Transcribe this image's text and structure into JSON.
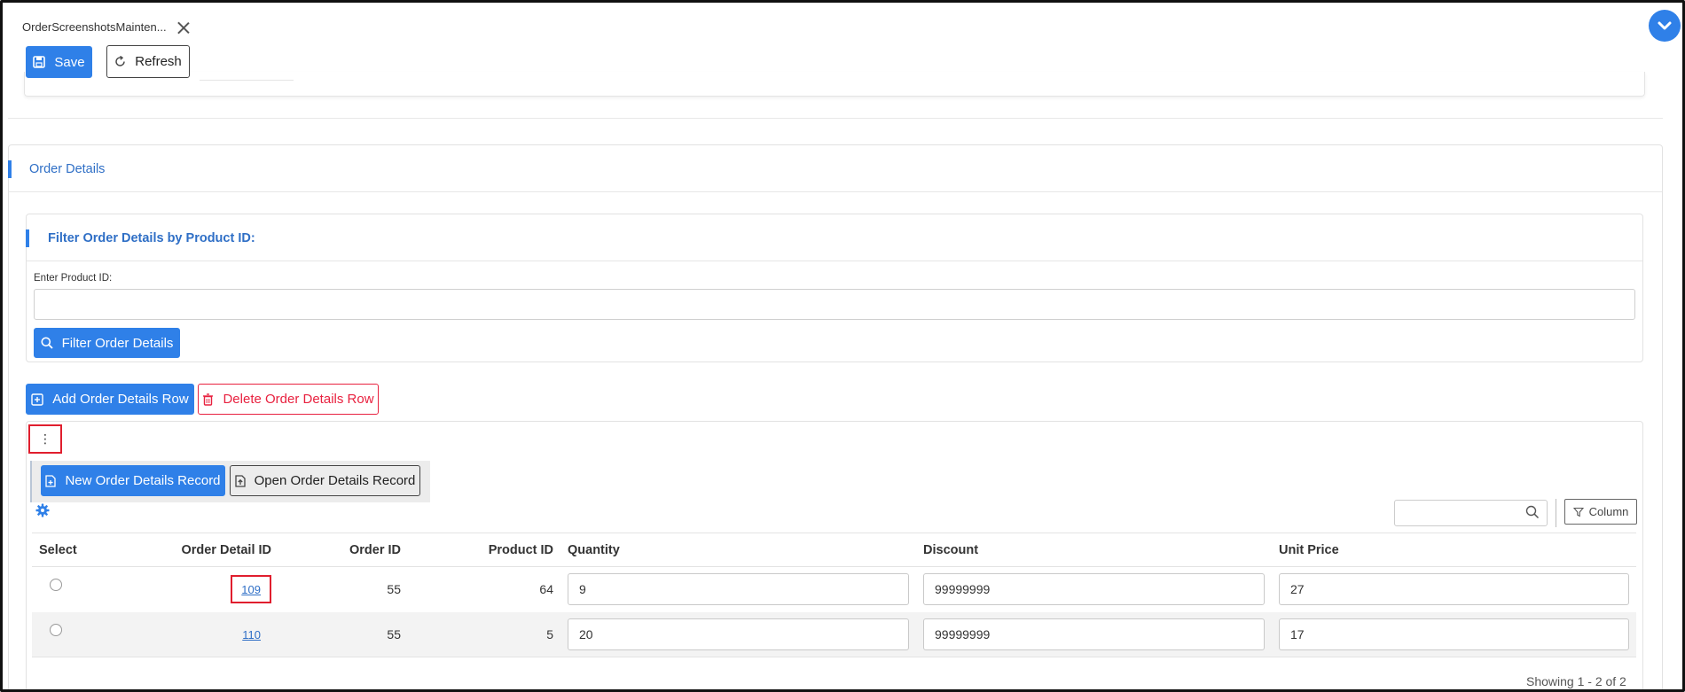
{
  "tab": {
    "title": "OrderScreenshotsMainten..."
  },
  "toolbar": {
    "save_label": "Save",
    "refresh_label": "Refresh"
  },
  "section": {
    "title": "Order Details"
  },
  "filter": {
    "title": "Filter Order Details by Product ID:",
    "field_label": "Enter Product ID:",
    "field_value": "",
    "button_label": "Filter Order Details"
  },
  "actions": {
    "add_label": "Add Order Details Row",
    "delete_label": "Delete Order Details Row"
  },
  "menu": {
    "kebab": "⋮",
    "new_label": "New Order Details Record",
    "open_label": "Open Order Details Record"
  },
  "grid": {
    "search_value": "",
    "column_button": "Column",
    "headers": {
      "select": "Select",
      "order_detail_id": "Order Detail ID",
      "order_id": "Order ID",
      "product_id": "Product ID",
      "quantity": "Quantity",
      "discount": "Discount",
      "unit_price": "Unit Price"
    },
    "rows": [
      {
        "order_detail_id": "109",
        "order_id": "55",
        "product_id": "64",
        "quantity": "9",
        "discount": "99999999",
        "unit_price": "27"
      },
      {
        "order_detail_id": "110",
        "order_id": "55",
        "product_id": "5",
        "quantity": "20",
        "discount": "99999999",
        "unit_price": "17"
      }
    ],
    "paging": "Showing 1 - 2 of 2"
  },
  "colors": {
    "primary": "#2f80e8",
    "danger": "#e8213f",
    "highlight": "#e01e2e",
    "link": "#2f6fc6"
  }
}
